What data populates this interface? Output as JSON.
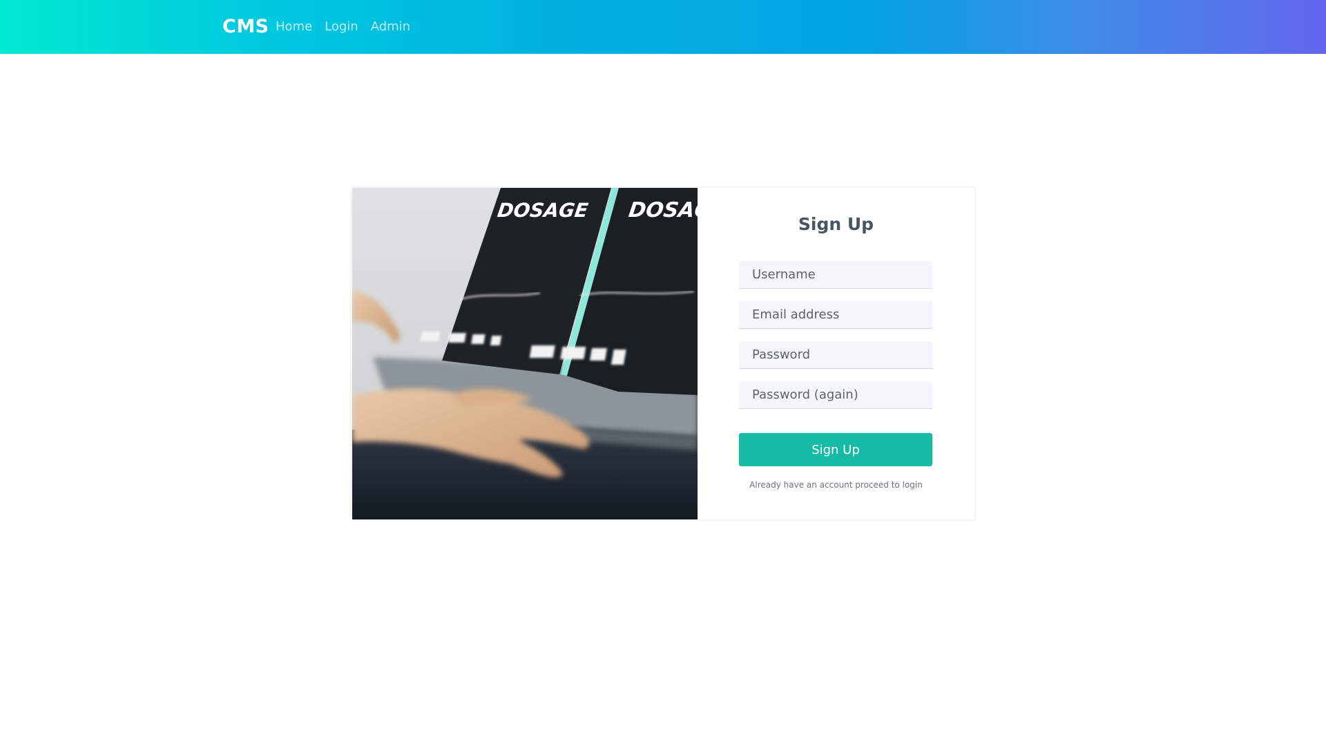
{
  "navbar": {
    "brand": "CMS",
    "links": [
      {
        "label": "Home"
      },
      {
        "label": "Login"
      },
      {
        "label": "Admin"
      }
    ]
  },
  "signup": {
    "title": "Sign Up",
    "fields": {
      "username": {
        "placeholder": "Username",
        "value": ""
      },
      "email": {
        "placeholder": "Email address",
        "value": ""
      },
      "password": {
        "placeholder": "Password",
        "value": ""
      },
      "password_again": {
        "placeholder": "Password (again)",
        "value": ""
      }
    },
    "submit_label": "Sign Up",
    "footer_note": "Already have an account proceed to login"
  },
  "photo": {
    "card_texts": [
      "DOSAGE",
      "DOSAGE"
    ]
  },
  "colors": {
    "accent": "#15bba5",
    "title": "#4a5563",
    "nav_gradient_start": "#00e8d0",
    "nav_gradient_end": "#6366ef"
  }
}
